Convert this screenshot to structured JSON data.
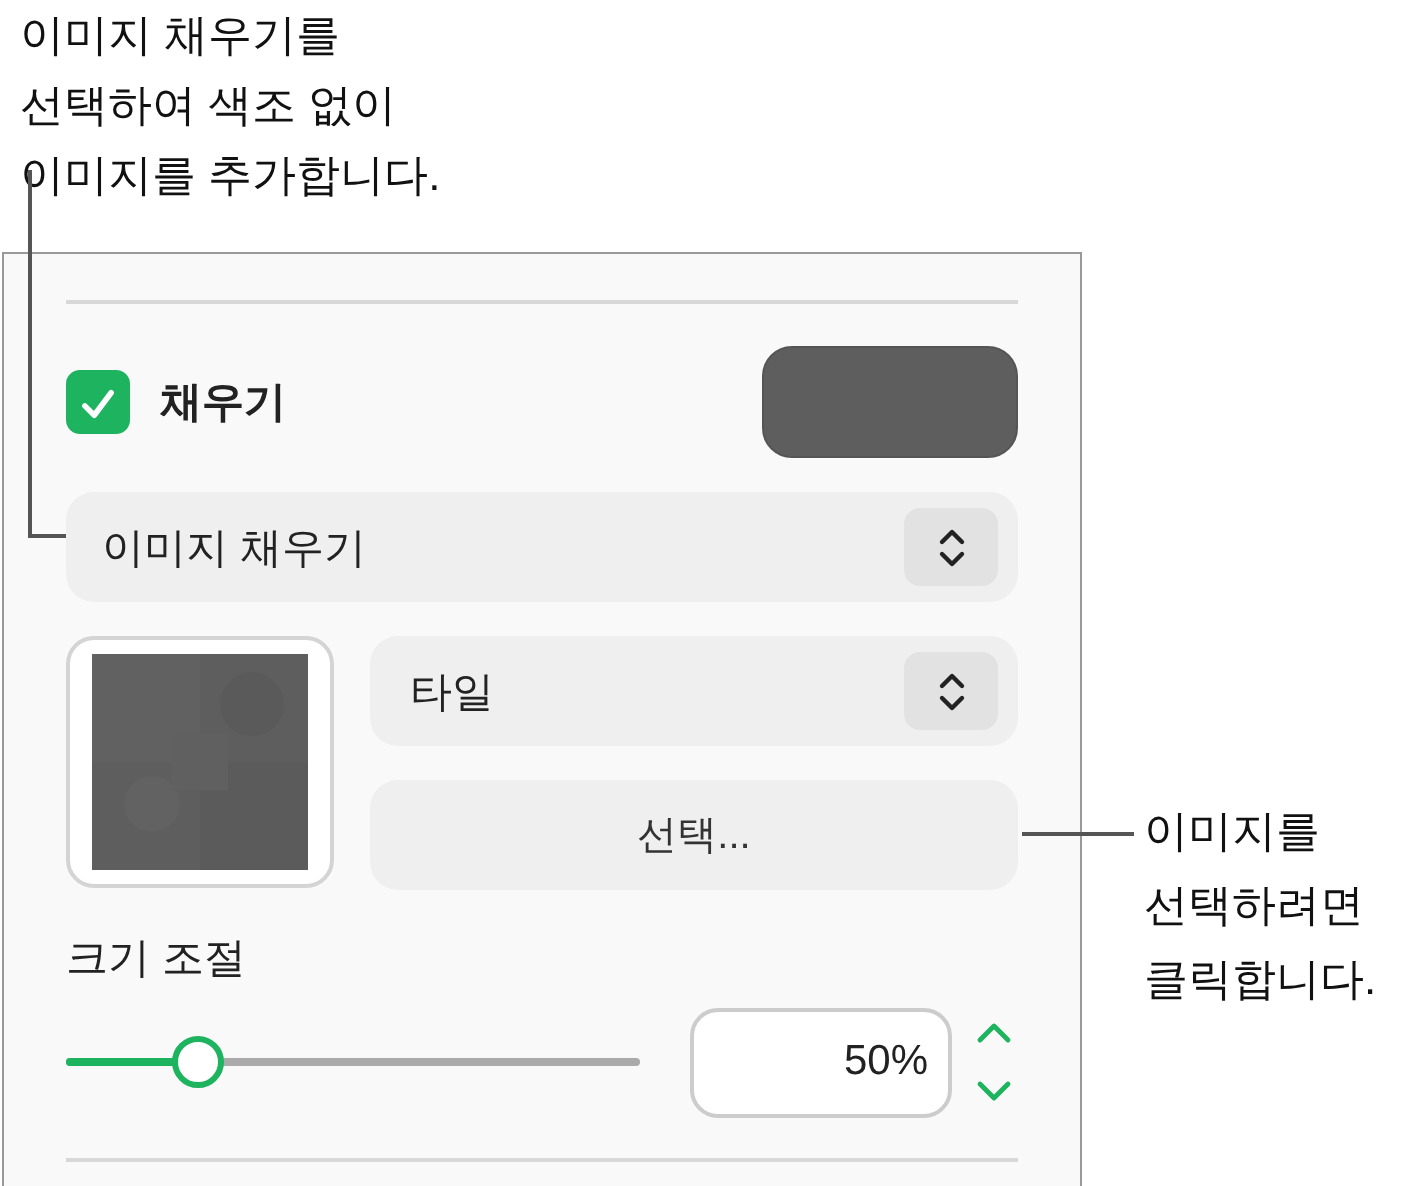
{
  "callouts": [
    {
      "lines": [
        "이미지 채우기를",
        "선택하여 색조 없이",
        "이미지를 추가합니다."
      ]
    },
    {
      "lines": [
        "이미지를",
        "선택하려면",
        "클릭합니다."
      ]
    }
  ],
  "fill": {
    "label": "채우기",
    "checked": true
  },
  "fill_type": {
    "value": "이미지 채우기"
  },
  "image_mode": {
    "value": "타일"
  },
  "choose_button": "선택...",
  "scale": {
    "label": "크기 조절",
    "level": 0.23,
    "value": "50%"
  }
}
